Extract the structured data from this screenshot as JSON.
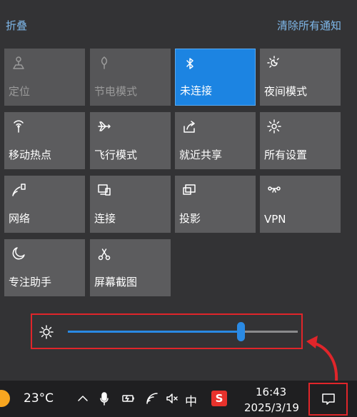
{
  "header": {
    "collapse_label": "折叠",
    "clear_all_label": "清除所有通知"
  },
  "tiles": [
    {
      "label": "定位",
      "icon": "location-icon",
      "state": "disabled"
    },
    {
      "label": "节电模式",
      "icon": "battery-saver-icon",
      "state": "disabled"
    },
    {
      "label": "未连接",
      "icon": "bluetooth-icon",
      "state": "active"
    },
    {
      "label": "夜间模式",
      "icon": "night-light-icon",
      "state": "normal"
    },
    {
      "label": "移动热点",
      "icon": "hotspot-icon",
      "state": "normal"
    },
    {
      "label": "飞行模式",
      "icon": "airplane-icon",
      "state": "normal"
    },
    {
      "label": "就近共享",
      "icon": "nearby-share-icon",
      "state": "normal"
    },
    {
      "label": "所有设置",
      "icon": "gear-icon",
      "state": "normal"
    },
    {
      "label": "网络",
      "icon": "network-icon",
      "state": "normal"
    },
    {
      "label": "连接",
      "icon": "connect-icon",
      "state": "normal"
    },
    {
      "label": "投影",
      "icon": "project-icon",
      "state": "normal"
    },
    {
      "label": "VPN",
      "icon": "vpn-icon",
      "state": "normal"
    },
    {
      "label": "专注助手",
      "icon": "moon-icon",
      "state": "normal"
    },
    {
      "label": "屏幕截图",
      "icon": "screen-snip-icon",
      "state": "normal"
    }
  ],
  "brightness": {
    "icon": "sun-icon",
    "value_fraction": 0.75
  },
  "taskbar": {
    "temperature": "23°C",
    "ime": "中",
    "sogou": "S",
    "time": "16:43",
    "date": "2025/3/19"
  },
  "colors": {
    "accent": "#1c84e2",
    "highlight_border": "#e0252a"
  }
}
